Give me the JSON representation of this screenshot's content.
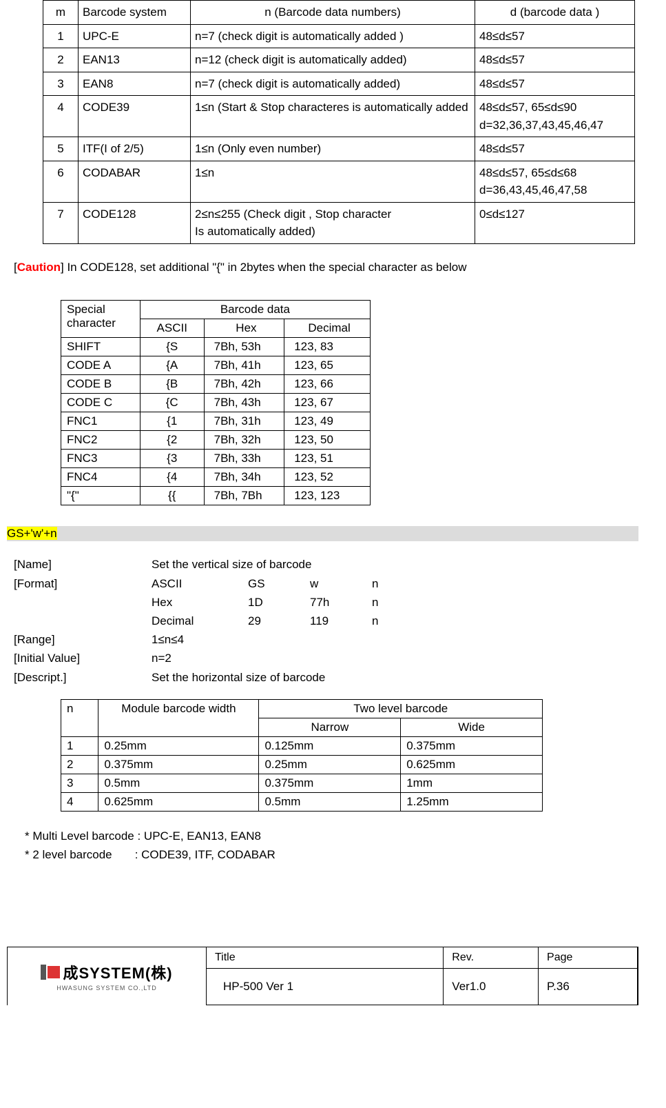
{
  "table1": {
    "head": {
      "m": "m",
      "system": "Barcode system",
      "n": "n   (Barcode data numbers)",
      "d": "d (barcode data )"
    },
    "rows": [
      {
        "m": "1",
        "system": "UPC-E",
        "n": "n=7 (check digit is automatically added )",
        "d": "48≤d≤57"
      },
      {
        "m": "2",
        "system": "EAN13",
        "n": "n=12 (check digit is automatically added)",
        "d": "48≤d≤57"
      },
      {
        "m": "3",
        "system": "EAN8",
        "n": "n=7 (check digit is automatically added)",
        "d": "48≤d≤57"
      },
      {
        "m": "4",
        "system": "CODE39",
        "n": "1≤n (Start & Stop characteres is automatically added",
        "d": "48≤d≤57, 65≤d≤90 d=32,36,37,43,45,46,47"
      },
      {
        "m": "5",
        "system": "ITF(I of 2/5)",
        "n": "1≤n   (Only even number)",
        "d": "48≤d≤57"
      },
      {
        "m": "6",
        "system": "CODABAR",
        "n": "1≤n",
        "d": "48≤d≤57, 65≤d≤68 d=36,43,45,46,47,58"
      },
      {
        "m": "7",
        "system": "CODE128",
        "n": "2≤n≤255 (Check digit , Stop character\n                    Is automatically added)",
        "d": "0≤d≤127"
      }
    ]
  },
  "caution": {
    "prefix": "[",
    "word": "Caution",
    "suffix": "] In CODE128, set additional \"{\" in 2bytes when the special character as below"
  },
  "table2": {
    "head": {
      "sp": "Special character",
      "bd": "Barcode data",
      "ascii": "ASCII",
      "hex": "Hex",
      "dec": "Decimal"
    },
    "rows": [
      {
        "sp": "SHIFT",
        "ascii": "{S",
        "hex": "7Bh, 53h",
        "dec": "123, 83"
      },
      {
        "sp": "CODE A",
        "ascii": "{A",
        "hex": "7Bh, 41h",
        "dec": "123, 65"
      },
      {
        "sp": "CODE B",
        "ascii": "{B",
        "hex": "7Bh, 42h",
        "dec": "123, 66"
      },
      {
        "sp": "CODE C",
        "ascii": "{C",
        "hex": "7Bh, 43h",
        "dec": "123, 67"
      },
      {
        "sp": "FNC1",
        "ascii": "{1",
        "hex": "7Bh, 31h",
        "dec": "123, 49"
      },
      {
        "sp": "FNC2",
        "ascii": "{2",
        "hex": "7Bh, 32h",
        "dec": "123, 50"
      },
      {
        "sp": "FNC3",
        "ascii": "{3",
        "hex": "7Bh, 33h",
        "dec": "123, 51"
      },
      {
        "sp": "FNC4",
        "ascii": "{4",
        "hex": "7Bh, 34h",
        "dec": "123, 52"
      },
      {
        "sp": "\"{\"",
        "ascii": "{{",
        "hex": "7Bh, 7Bh",
        "dec": "123, 123"
      }
    ]
  },
  "section": {
    "cmd": "GS+'w'+n"
  },
  "spec": {
    "name_label": "[Name]",
    "name_val": "Set the vertical size of barcode",
    "format_label": "[Format]",
    "fmt_rows": [
      [
        "ASCII",
        "GS",
        "w",
        "n"
      ],
      [
        "Hex",
        "1D",
        "77h",
        "n"
      ],
      [
        "Decimal",
        "29",
        "119",
        "n"
      ]
    ],
    "range_label": "[Range]",
    "range_val": "1≤n≤4",
    "init_label": "[Initial Value]",
    "init_val": "n=2",
    "desc_label": "[Descript.]",
    "desc_val": "Set the horizontal size of barcode"
  },
  "table3": {
    "head": {
      "n": "n",
      "mod": "Module barcode width",
      "two": "Two level barcode",
      "narrow": "Narrow",
      "wide": "Wide"
    },
    "rows": [
      {
        "n": "1",
        "mod": "0.25mm",
        "narrow": "0.125mm",
        "wide": "0.375mm"
      },
      {
        "n": "2",
        "mod": "0.375mm",
        "narrow": "0.25mm",
        "wide": "0.625mm"
      },
      {
        "n": "3",
        "mod": "0.5mm",
        "narrow": "0.375mm",
        "wide": "1mm"
      },
      {
        "n": "4",
        "mod": "0.625mm",
        "narrow": "0.5mm",
        "wide": "1.25mm"
      }
    ]
  },
  "notes": {
    "a": "* Multi Level barcode : UPC-E, EAN13, EAN8",
    "b": "* 2 level barcode       : CODE39, ITF, CODABAR"
  },
  "footer": {
    "logo_line1": "成SYSTEM(株)",
    "logo_line2": "HWASUNG SYSTEM CO.,LTD",
    "title_label": "Title",
    "rev_label": "Rev.",
    "page_label": "Page",
    "title_val": "HP-500 Ver 1",
    "rev_val": "Ver1.0",
    "page_val": "P.36"
  }
}
